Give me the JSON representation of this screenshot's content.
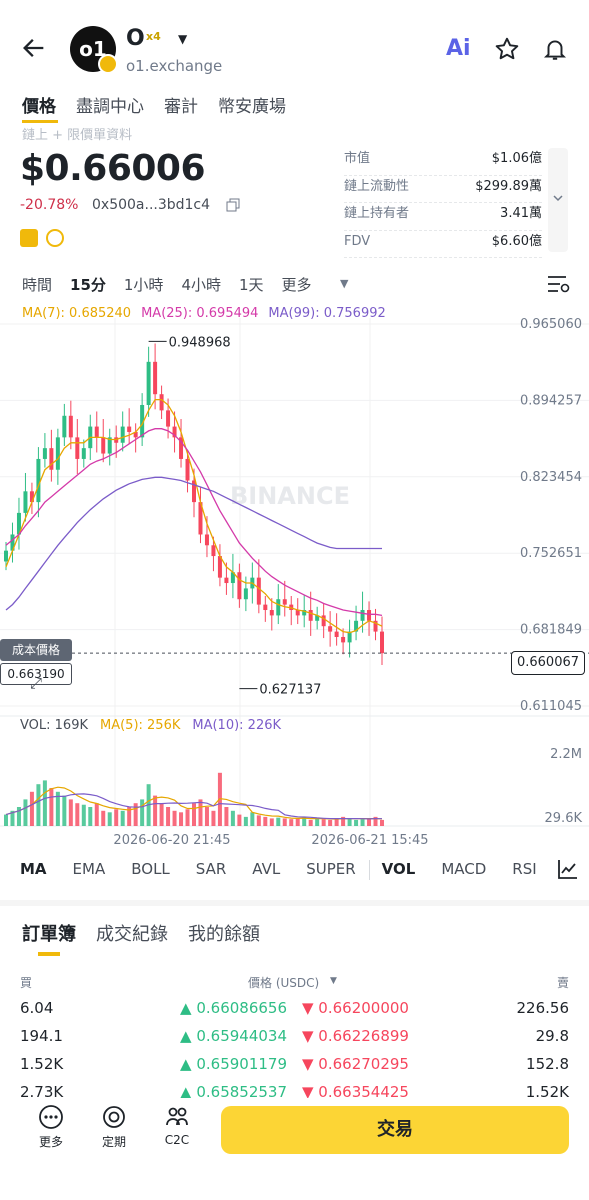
{
  "header": {
    "token_name": "O",
    "token_badge": "x4",
    "subtitle": "o1.exchange",
    "ai_label": "Ai"
  },
  "tabs": [
    {
      "label": "價格",
      "active": true
    },
    {
      "label": "盡調中心",
      "active": false
    },
    {
      "label": "審計",
      "active": false
    },
    {
      "label": "幣安廣場",
      "active": false
    }
  ],
  "faded_label": "鏈上 + 限價單資料",
  "price": "$0.66006",
  "change": "-20.78%",
  "address": "0x500a...3bd1c4",
  "stats": [
    {
      "label": "市值",
      "value": "$1.06億"
    },
    {
      "label": "鏈上流動性",
      "value": "$299.89萬"
    },
    {
      "label": "鏈上持有者",
      "value": "3.41萬"
    },
    {
      "label": "FDV",
      "value": "$6.60億"
    }
  ],
  "intervals": [
    {
      "label": "時間",
      "active": false
    },
    {
      "label": "15分",
      "active": true
    },
    {
      "label": "1小時",
      "active": false
    },
    {
      "label": "4小時",
      "active": false
    },
    {
      "label": "1天",
      "active": false
    },
    {
      "label": "更多",
      "active": false
    }
  ],
  "ma_legend": [
    {
      "label": "MA(7): 0.685240",
      "color": "#e6a700"
    },
    {
      "label": "MA(25): 0.695494",
      "color": "#d43aa9"
    },
    {
      "label": "MA(99): 0.756992",
      "color": "#7b5cc9"
    }
  ],
  "chart_data": {
    "type": "candlestick",
    "y_ticks": [
      "0.965060",
      "0.894257",
      "0.823454",
      "0.752651",
      "0.681849",
      "0.611045"
    ],
    "ylim": [
      0.611045,
      0.96506
    ],
    "current_price": "0.660067",
    "high_label": "0.948968",
    "low_label": "0.627137",
    "cost_label": "成本價格",
    "cost_value": "0.663190",
    "watermark": "BINANCE",
    "x_ticks": [
      "2026-06-20 21:45",
      "2026-06-21 15:45"
    ],
    "closes": [
      0.755,
      0.77,
      0.79,
      0.81,
      0.8,
      0.84,
      0.85,
      0.83,
      0.86,
      0.88,
      0.86,
      0.84,
      0.85,
      0.87,
      0.86,
      0.845,
      0.86,
      0.855,
      0.87,
      0.865,
      0.86,
      0.89,
      0.93,
      0.9,
      0.885,
      0.87,
      0.86,
      0.84,
      0.82,
      0.8,
      0.77,
      0.76,
      0.75,
      0.73,
      0.725,
      0.735,
      0.71,
      0.72,
      0.73,
      0.705,
      0.7,
      0.695,
      0.71,
      0.705,
      0.7,
      0.695,
      0.7,
      0.69,
      0.695,
      0.685,
      0.68,
      0.675,
      0.67,
      0.68,
      0.69,
      0.7,
      0.69,
      0.68,
      0.66
    ],
    "ma7": [
      0.74,
      0.755,
      0.77,
      0.785,
      0.8,
      0.815,
      0.83,
      0.835,
      0.84,
      0.85,
      0.855,
      0.855,
      0.855,
      0.86,
      0.86,
      0.86,
      0.858,
      0.858,
      0.86,
      0.862,
      0.865,
      0.872,
      0.885,
      0.895,
      0.895,
      0.89,
      0.88,
      0.865,
      0.845,
      0.825,
      0.8,
      0.78,
      0.765,
      0.75,
      0.74,
      0.735,
      0.728,
      0.725,
      0.725,
      0.72,
      0.715,
      0.708,
      0.705,
      0.703,
      0.702,
      0.7,
      0.699,
      0.697,
      0.695,
      0.692,
      0.688,
      0.684,
      0.68,
      0.679,
      0.681,
      0.686,
      0.69,
      0.688,
      0.685
    ],
    "ma25": [
      0.76,
      0.765,
      0.77,
      0.778,
      0.785,
      0.792,
      0.8,
      0.805,
      0.81,
      0.815,
      0.82,
      0.825,
      0.83,
      0.835,
      0.838,
      0.84,
      0.843,
      0.846,
      0.85,
      0.854,
      0.858,
      0.862,
      0.866,
      0.868,
      0.868,
      0.866,
      0.862,
      0.856,
      0.848,
      0.838,
      0.828,
      0.816,
      0.804,
      0.792,
      0.782,
      0.772,
      0.762,
      0.755,
      0.748,
      0.742,
      0.736,
      0.731,
      0.727,
      0.723,
      0.72,
      0.717,
      0.714,
      0.711,
      0.709,
      0.706,
      0.704,
      0.702,
      0.7,
      0.699,
      0.698,
      0.697,
      0.696,
      0.696,
      0.695
    ],
    "ma99": [
      0.7,
      0.705,
      0.712,
      0.72,
      0.728,
      0.736,
      0.744,
      0.752,
      0.76,
      0.767,
      0.774,
      0.781,
      0.787,
      0.793,
      0.798,
      0.803,
      0.807,
      0.811,
      0.814,
      0.817,
      0.819,
      0.821,
      0.822,
      0.823,
      0.823,
      0.822,
      0.821,
      0.82,
      0.818,
      0.816,
      0.814,
      0.812,
      0.81,
      0.807,
      0.804,
      0.801,
      0.798,
      0.795,
      0.792,
      0.789,
      0.786,
      0.783,
      0.78,
      0.777,
      0.774,
      0.771,
      0.768,
      0.765,
      0.762,
      0.76,
      0.758,
      0.757,
      0.757,
      0.757,
      0.757,
      0.757,
      0.757,
      0.757,
      0.757
    ],
    "vol_ticks": [
      "2.2M",
      "29.6K"
    ],
    "volumes": [
      0.15,
      0.2,
      0.25,
      0.35,
      0.45,
      0.55,
      0.6,
      0.5,
      0.45,
      0.4,
      0.35,
      0.3,
      0.28,
      0.25,
      0.3,
      0.2,
      0.18,
      0.22,
      0.2,
      0.25,
      0.3,
      0.35,
      0.55,
      0.4,
      0.3,
      0.25,
      0.2,
      0.18,
      0.22,
      0.3,
      0.35,
      0.25,
      0.2,
      0.7,
      0.25,
      0.2,
      0.15,
      0.12,
      0.18,
      0.14,
      0.12,
      0.1,
      0.11,
      0.1,
      0.09,
      0.1,
      0.12,
      0.08,
      0.1,
      0.09,
      0.08,
      0.1,
      0.12,
      0.1,
      0.08,
      0.09,
      0.1,
      0.12,
      0.08
    ]
  },
  "vol_legend": [
    {
      "label": "VOL: 169K",
      "color": "#474d57"
    },
    {
      "label": "MA(5): 256K",
      "color": "#e6a700"
    },
    {
      "label": "MA(10): 226K",
      "color": "#7b5cc9"
    }
  ],
  "indicators": [
    {
      "label": "MA",
      "active": true
    },
    {
      "label": "EMA",
      "active": false
    },
    {
      "label": "BOLL",
      "active": false
    },
    {
      "label": "SAR",
      "active": false
    },
    {
      "label": "AVL",
      "active": false
    },
    {
      "label": "SUPER",
      "active": false
    },
    {
      "label": "VOL",
      "active": true
    },
    {
      "label": "MACD",
      "active": false
    },
    {
      "label": "RSI",
      "active": false
    }
  ],
  "orderbook": {
    "tabs": [
      {
        "label": "訂單簿",
        "active": true
      },
      {
        "label": "成交紀錄",
        "active": false
      },
      {
        "label": "我的餘額",
        "active": false
      }
    ],
    "buy_label": "買",
    "price_label": "價格 (USDC)",
    "sell_label": "賣",
    "rows": [
      {
        "buy_qty": "6.04",
        "bid": "0.66086656",
        "ask": "0.66200000",
        "sell_qty": "226.56"
      },
      {
        "buy_qty": "194.1",
        "bid": "0.65944034",
        "ask": "0.66226899",
        "sell_qty": "29.8"
      },
      {
        "buy_qty": "1.52K",
        "bid": "0.65901179",
        "ask": "0.66270295",
        "sell_qty": "152.8"
      },
      {
        "buy_qty": "2.73K",
        "bid": "0.65852537",
        "ask": "0.66354425",
        "sell_qty": "1.52K"
      }
    ]
  },
  "bottom_nav": [
    {
      "label": "更多",
      "icon": "more-icon"
    },
    {
      "label": "定期",
      "icon": "savings-icon"
    },
    {
      "label": "C2C",
      "icon": "c2c-icon"
    }
  ],
  "trade_label": "交易",
  "colors": {
    "up": "#2ebd85",
    "down": "#f6465d",
    "accent": "#fcd535"
  }
}
